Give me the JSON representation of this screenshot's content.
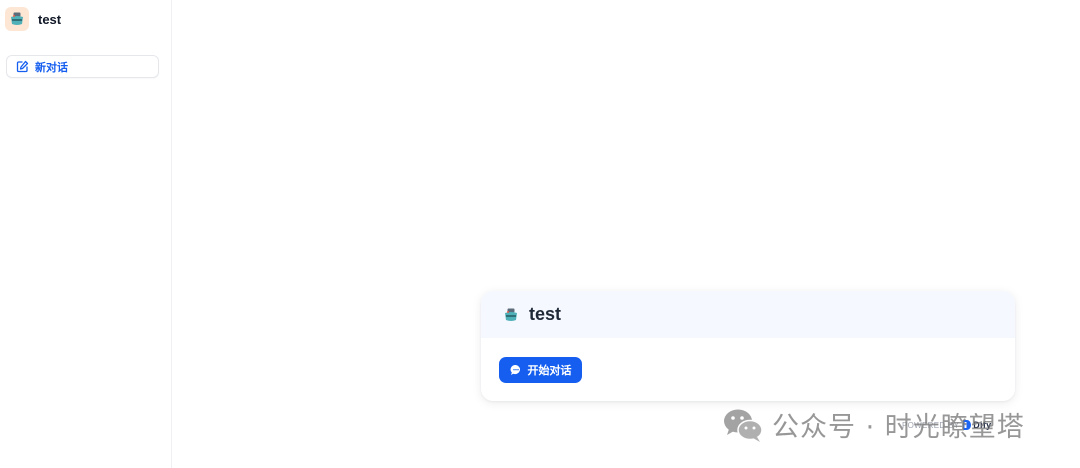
{
  "sidebar": {
    "app_title": "test",
    "new_chat_label": "新对话"
  },
  "card": {
    "title": "test",
    "start_button_label": "开始对话"
  },
  "footer": {
    "powered_by": "POWERED BY",
    "brand": "Dify"
  },
  "watermark": {
    "text": "公众号 · 时光瞭望塔"
  },
  "colors": {
    "primary": "#155eef",
    "card_header_bg": "#f5f8ff",
    "app_icon_bg": "#fde6d3"
  },
  "icons": {
    "app": "robot-icon",
    "new_chat": "edit-icon",
    "start": "chat-bubble-icon",
    "brand": "dify-logo-icon",
    "watermark": "wechat-icon"
  }
}
